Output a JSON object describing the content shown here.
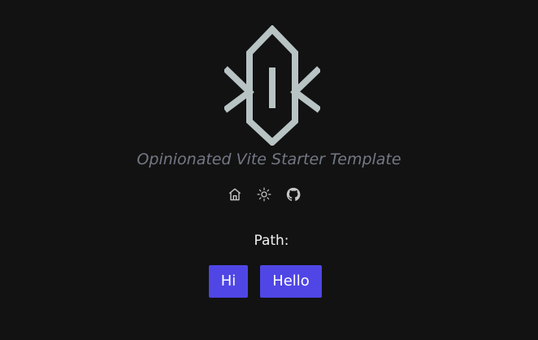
{
  "header": {
    "logo_icon": "vitesse-logo-icon",
    "tagline": "Opinionated Vite Starter Template"
  },
  "nav": [
    {
      "icon": "home-icon"
    },
    {
      "icon": "sun-icon"
    },
    {
      "icon": "github-icon"
    }
  ],
  "path": {
    "label": "Path:"
  },
  "buttons": {
    "hi_label": "Hi",
    "hello_label": "Hello"
  },
  "colors": {
    "background": "#121212",
    "logo": "#b8c3c4",
    "muted_text": "#737885",
    "nav_icon": "#c6c6c6",
    "primary_button": "#4f46e5"
  }
}
